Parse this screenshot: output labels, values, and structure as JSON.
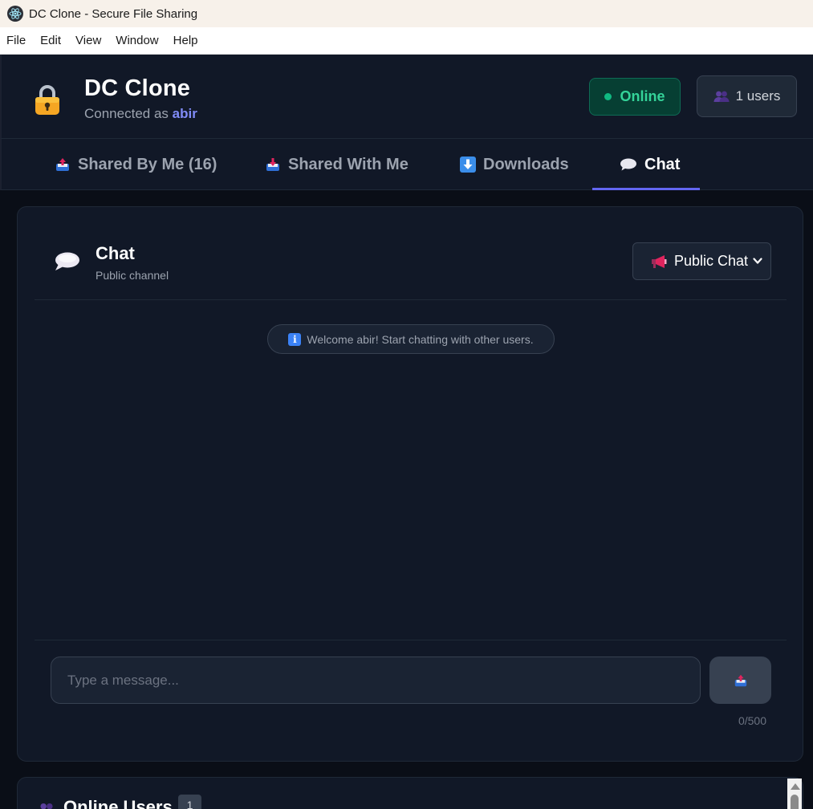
{
  "window": {
    "title": "DC Clone - Secure File Sharing",
    "icon": "electron-atom-icon"
  },
  "menu": {
    "items": [
      "File",
      "Edit",
      "View",
      "Window",
      "Help"
    ]
  },
  "header": {
    "brand": "DC Clone",
    "connected_prefix": "Connected as",
    "username": "abir",
    "status": "Online",
    "users_label": "1 users",
    "colors": {
      "online": "#10b981",
      "accent": "#6366f1",
      "username": "#818cf8"
    }
  },
  "tabs": [
    {
      "label": "Shared By Me (16)",
      "icon": "outbox-tray-icon",
      "active": false
    },
    {
      "label": "Shared With Me",
      "icon": "inbox-tray-icon",
      "active": false
    },
    {
      "label": "Downloads",
      "icon": "down-arrow-icon",
      "active": false
    },
    {
      "label": "Chat",
      "icon": "speech-bubble-icon",
      "active": true
    }
  ],
  "chat": {
    "title": "Chat",
    "subtitle": "Public channel",
    "channel_selected": "Public Chat",
    "welcome": "Welcome abir! Start chatting with other users.",
    "input_placeholder": "Type a message...",
    "input_value": "",
    "char_count": "0/500"
  },
  "online": {
    "title": "Online Users",
    "count": "1"
  }
}
